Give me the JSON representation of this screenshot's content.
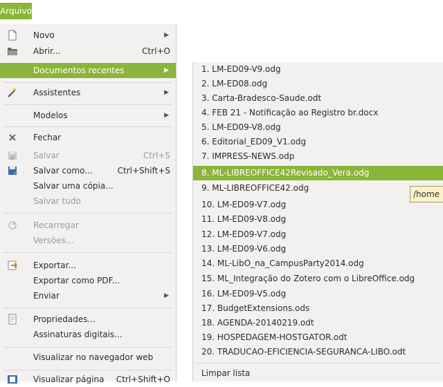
{
  "menubar": {
    "active_menu": "Arquivo"
  },
  "file_menu": {
    "items": [
      {
        "label": "Novo",
        "accel": "",
        "submenu": true,
        "icon": "new-document-icon"
      },
      {
        "label": "Abrir...",
        "accel": "Ctrl+O",
        "submenu": false,
        "icon": "open-folder-icon"
      },
      {
        "label": "Documentos recentes",
        "accel": "",
        "submenu": true,
        "icon": ""
      },
      {
        "label": "Assistentes",
        "accel": "",
        "submenu": true,
        "icon": "wizard-icon"
      },
      {
        "label": "Modelos",
        "accel": "",
        "submenu": true,
        "icon": ""
      },
      {
        "label": "Fechar",
        "accel": "",
        "submenu": false,
        "icon": "close-icon"
      },
      {
        "label": "Salvar",
        "accel": "Ctrl+S",
        "submenu": false,
        "icon": "save-icon"
      },
      {
        "label": "Salvar como...",
        "accel": "Ctrl+Shift+S",
        "submenu": false,
        "icon": "save-as-icon"
      },
      {
        "label": "Salvar uma cópia...",
        "accel": "",
        "submenu": false,
        "icon": ""
      },
      {
        "label": "Salvar tudo",
        "accel": "",
        "submenu": false,
        "icon": ""
      },
      {
        "label": "Recarregar",
        "accel": "",
        "submenu": false,
        "icon": "reload-icon"
      },
      {
        "label": "Versões...",
        "accel": "",
        "submenu": false,
        "icon": ""
      },
      {
        "label": "Exportar...",
        "accel": "",
        "submenu": false,
        "icon": "export-icon"
      },
      {
        "label": "Exportar como PDF...",
        "accel": "",
        "submenu": false,
        "icon": ""
      },
      {
        "label": "Enviar",
        "accel": "",
        "submenu": true,
        "icon": ""
      },
      {
        "label": "Propriedades...",
        "accel": "",
        "submenu": false,
        "icon": "properties-icon"
      },
      {
        "label": "Assinaturas digitais...",
        "accel": "",
        "submenu": false,
        "icon": ""
      },
      {
        "label": "Visualizar no navegador web",
        "accel": "",
        "submenu": false,
        "icon": ""
      },
      {
        "label": "Visualizar página",
        "accel": "Ctrl+Shift+O",
        "submenu": false,
        "icon": "page-preview-icon"
      }
    ]
  },
  "recent_menu": {
    "items": [
      "1. LM-ED09-V9.odg",
      "2. LM-ED08.odg",
      "3. Carta-Bradesco-Saude.odt",
      "4. FEB 21 - Notificação ao Registro br.docx",
      "5. LM-ED09-V8.odg",
      "6. Editorial_ED09_V1.odg",
      "7. IMPRESS-NEWS.odp",
      "8. ML-LIBREOFFICE42Revisado_Vera.odg",
      "9. ML-LIBREOFFICE42.odg",
      "10. LM-ED09-V7.odg",
      "11. LM-ED09-V8.odg",
      "12. LM-ED09-V7.odg",
      "13. LM-ED09-V6.odg",
      "14. ML-LibO_na_CampusParty2014.odg",
      "15. ML_Integração do Zotero com o LibreOffice.odg",
      "16. LM-ED09-V5.odg",
      "17. BudgetExtensions.ods",
      "18. AGENDA-20140219.odt",
      "19. HOSPEDAGEM-HOSTGATOR.odt",
      "20. TRADUCAO-EFICIENCIA-SEGURANCA-LIBO.odt"
    ],
    "clear_label": "Limpar lista"
  },
  "tooltip": {
    "text": "/home"
  },
  "colors": {
    "highlight": "#8ab53a",
    "menu_bg": "#f2f1f0",
    "disabled_text": "#9a9a9a"
  }
}
